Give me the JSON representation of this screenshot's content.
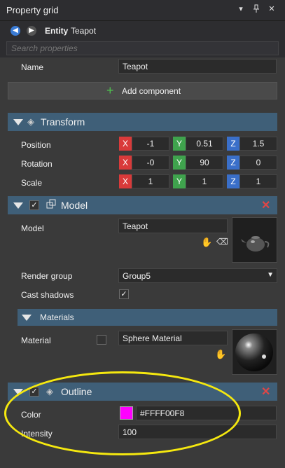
{
  "window": {
    "title": "Property grid",
    "controls": [
      "▾",
      "⊥",
      "✕"
    ]
  },
  "nav": {
    "prefix": "Entity",
    "entity_name": "Teapot"
  },
  "search": {
    "placeholder": "Search properties"
  },
  "entity": {
    "name_label": "Name",
    "name_value": "Teapot",
    "add_component_label": "Add component"
  },
  "transform": {
    "title": "Transform",
    "rows": [
      {
        "label": "Position",
        "x": "-1",
        "y": "0.51",
        "z": "1.5"
      },
      {
        "label": "Rotation",
        "x": "-0",
        "y": "90",
        "z": "0"
      },
      {
        "label": "Scale",
        "x": "1",
        "y": "1",
        "z": "1"
      }
    ],
    "axis_labels": {
      "x": "X",
      "y": "Y",
      "z": "Z"
    }
  },
  "model": {
    "title": "Model",
    "model_label": "Model",
    "model_value": "Teapot",
    "render_group_label": "Render group",
    "render_group_value": "Group5",
    "cast_shadows_label": "Cast shadows",
    "cast_shadows_checked": true,
    "materials_title": "Materials",
    "material_label": "Material",
    "material_value": "Sphere Material"
  },
  "outline": {
    "title": "Outline",
    "color_label": "Color",
    "color_value": "#FFFF00F8",
    "color_swatch": "#ff00ff",
    "intensity_label": "Intensity",
    "intensity_value": "100"
  },
  "colors": {
    "section_header": "#3f5f78",
    "panel": "#3a3a3a",
    "annotation": "#f5e80f"
  }
}
